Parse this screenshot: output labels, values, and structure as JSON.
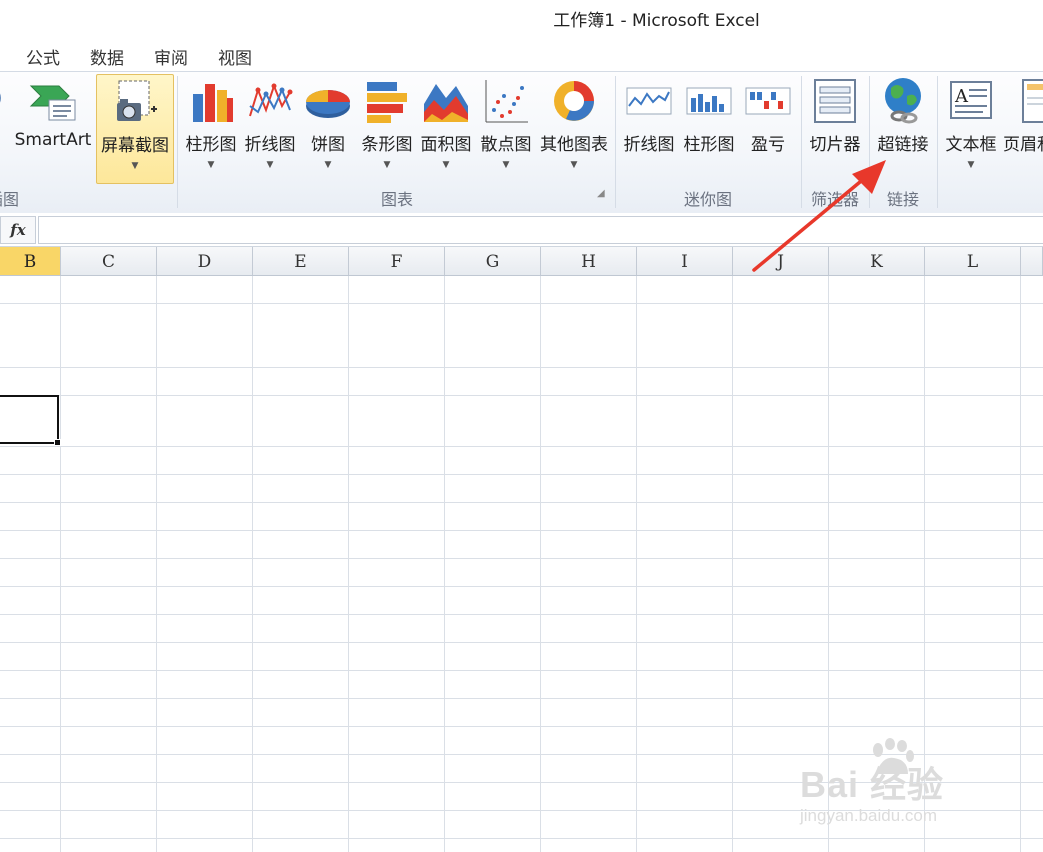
{
  "window": {
    "title": "工作簿1 - Microsoft Excel"
  },
  "menu_tabs": [
    "公式",
    "数据",
    "审阅",
    "视图"
  ],
  "ribbon": {
    "buttons": {
      "partial_left": "",
      "smartart": "SmartArt",
      "screenshot": "屏幕截图",
      "column_chart": "柱形图",
      "line_chart": "折线图",
      "pie_chart": "饼图",
      "bar_chart": "条形图",
      "area_chart": "面积图",
      "scatter_chart": "散点图",
      "other_charts": "其他图表",
      "sparkline_line": "折线图",
      "sparkline_column": "柱形图",
      "sparkline_winloss": "盈亏",
      "slicer": "切片器",
      "hyperlink": "超链接",
      "textbox": "文本框",
      "header_footer": "页眉和"
    },
    "groups": {
      "illustrations": "插图",
      "charts": "图表",
      "sparklines": "迷你图",
      "filter": "筛选器",
      "links": "链接"
    }
  },
  "formula_bar": {
    "fx_label": "fx",
    "value": ""
  },
  "columns": [
    "B",
    "C",
    "D",
    "E",
    "F",
    "G",
    "H",
    "I",
    "J",
    "K",
    "L"
  ],
  "selected_column": "B",
  "watermark": {
    "main": "Bai 经验",
    "sub": "jingyan.baidu.com"
  },
  "colors": {
    "accent_selected": "#f9d667",
    "arrow": "#e8382b",
    "grid_line": "#dadfe6"
  }
}
